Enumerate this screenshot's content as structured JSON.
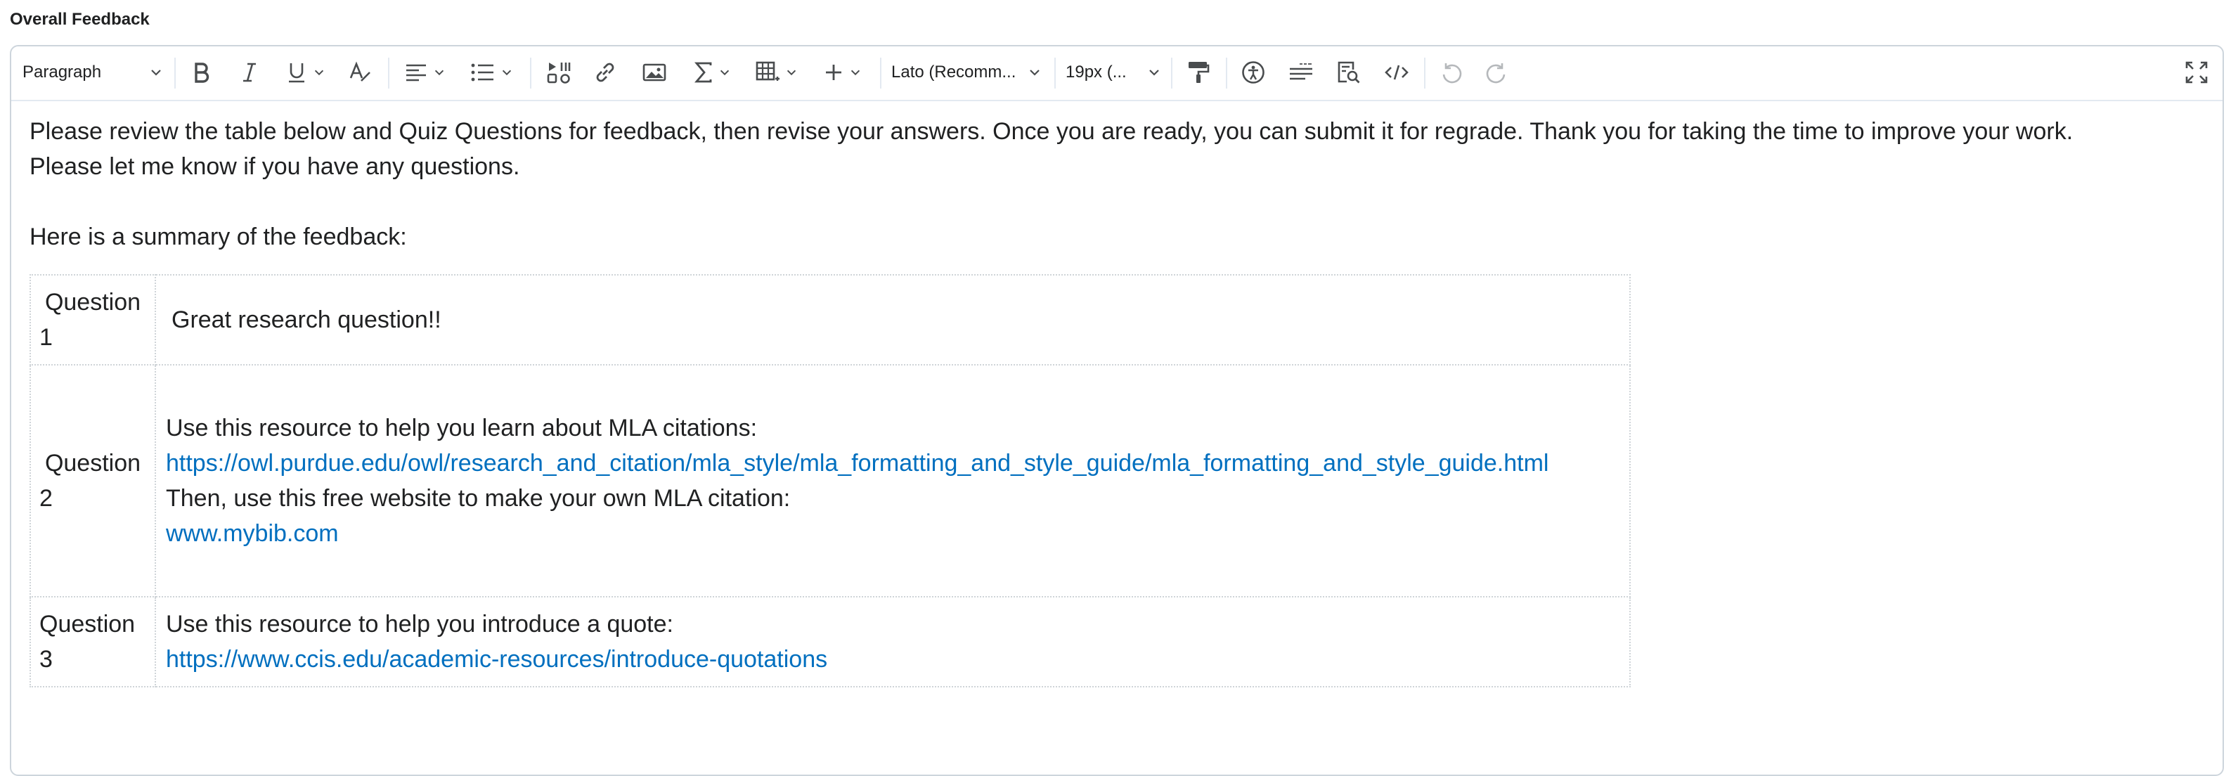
{
  "section_label": "Overall Feedback",
  "toolbar": {
    "format_select": "Paragraph",
    "font_select": "Lato (Recomm...",
    "size_select": "19px (..."
  },
  "content": {
    "intro_line1": "Please review the table below and Quiz Questions for feedback, then revise your answers. Once you are ready, you can submit it for regrade. Thank you for taking the time to improve your work.",
    "intro_line2": "Please let me know if you have any questions.",
    "summary": "Here is a summary of the feedback:",
    "rows": [
      {
        "question_word": "Question",
        "question_num": "1",
        "text1": "Great research question!!"
      },
      {
        "question_word": "Question",
        "question_num": "2",
        "text1": "Use this resource to help you learn about MLA citations:",
        "link1": "https://owl.purdue.edu/owl/research_and_citation/mla_style/mla_formatting_and_style_guide/mla_formatting_and_style_guide.html",
        "text2": "Then, use this free website to make your own MLA citation:",
        "link2": "www.mybib.com"
      },
      {
        "question_word": "Question",
        "question_num": "3",
        "text1": "Use this resource to help you introduce a quote:",
        "link1": "https://www.ccis.edu/academic-resources/introduce-quotations"
      }
    ]
  },
  "colors": {
    "link": "#006fbf",
    "text": "#202122",
    "border": "#cdd5dc"
  }
}
